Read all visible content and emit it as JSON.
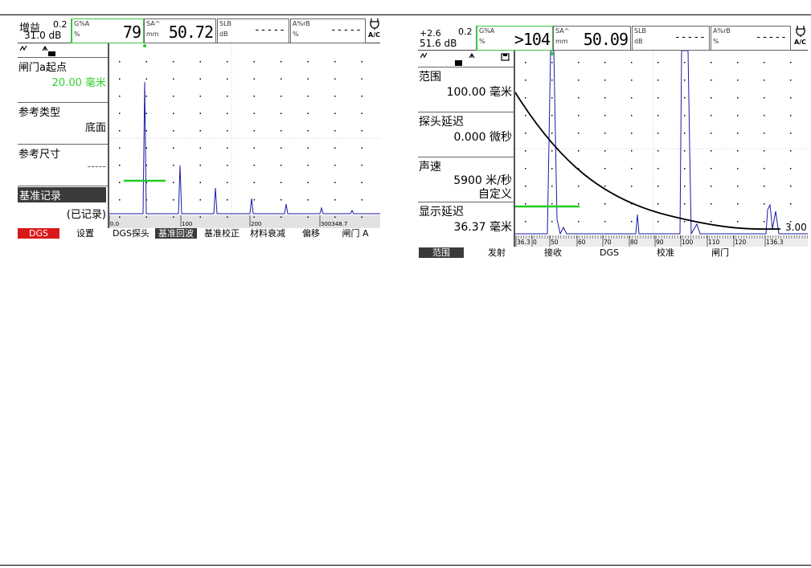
{
  "left_screen": {
    "header": {
      "gain_label": "增益",
      "gain_step": "0.2",
      "gain_value": "31.0 dB",
      "cells": [
        {
          "u1": "G%A",
          "u2": "%",
          "value": "79"
        },
        {
          "u1": "SA^",
          "u2": "mm",
          "value": "50.72"
        },
        {
          "u1": "SLB",
          "u2": "dB",
          "value": "-----"
        },
        {
          "u1": "A%rB",
          "u2": "%",
          "value": "-----"
        }
      ],
      "mode": "A/C"
    },
    "menu": [
      {
        "title": "闸门a起点",
        "value": "20.00 毫米",
        "value_color": "#2fcf2f"
      },
      {
        "title": "参考类型",
        "value": "底面"
      },
      {
        "title": "参考尺寸",
        "value": "-----"
      },
      {
        "title": "基准记录",
        "value": "(已记录)",
        "selected": true
      }
    ],
    "axis_labels": [
      "0.0",
      "100",
      "200",
      "300348.7"
    ],
    "bottom_bar": [
      "DGS",
      "设置",
      "DGS探头",
      "基准回波",
      "基准校正",
      "材料衰减",
      "偏移",
      "闸门 A"
    ]
  },
  "right_screen": {
    "header": {
      "gain_label": "+2.6",
      "gain_step": "0.2",
      "gain_value": "51.6 dB",
      "cells": [
        {
          "u1": "G%A",
          "u2": "%",
          "value": ">104"
        },
        {
          "u1": "SA^",
          "u2": "mm",
          "value": "50.09"
        },
        {
          "u1": "SLB",
          "u2": "dB",
          "value": "-----"
        },
        {
          "u1": "A%rB",
          "u2": "%",
          "value": "-----"
        }
      ],
      "mode": "A/C"
    },
    "menu": [
      {
        "title": "范围",
        "value": "100.00 毫米"
      },
      {
        "title": "探头延迟",
        "value": "0.000 微秒"
      },
      {
        "title": "声速",
        "value": "5900 米/秒",
        "value2": "自定义"
      },
      {
        "title": "显示延迟",
        "value": "36.37 毫米"
      }
    ],
    "axis_labels": [
      "36.3",
      "0",
      "50",
      "60",
      "70",
      "80",
      "90",
      "100",
      "110",
      "120",
      "136.3"
    ],
    "curve_label": "3.00",
    "bottom_bar": [
      "范围",
      "发射",
      "接收",
      "DGS",
      "校准",
      "闸门"
    ]
  },
  "colors": {
    "gate": "#22cc22",
    "echo": "#1a1aa8",
    "dgs_tab": "#d71919",
    "selected": "#3a3a3a"
  }
}
